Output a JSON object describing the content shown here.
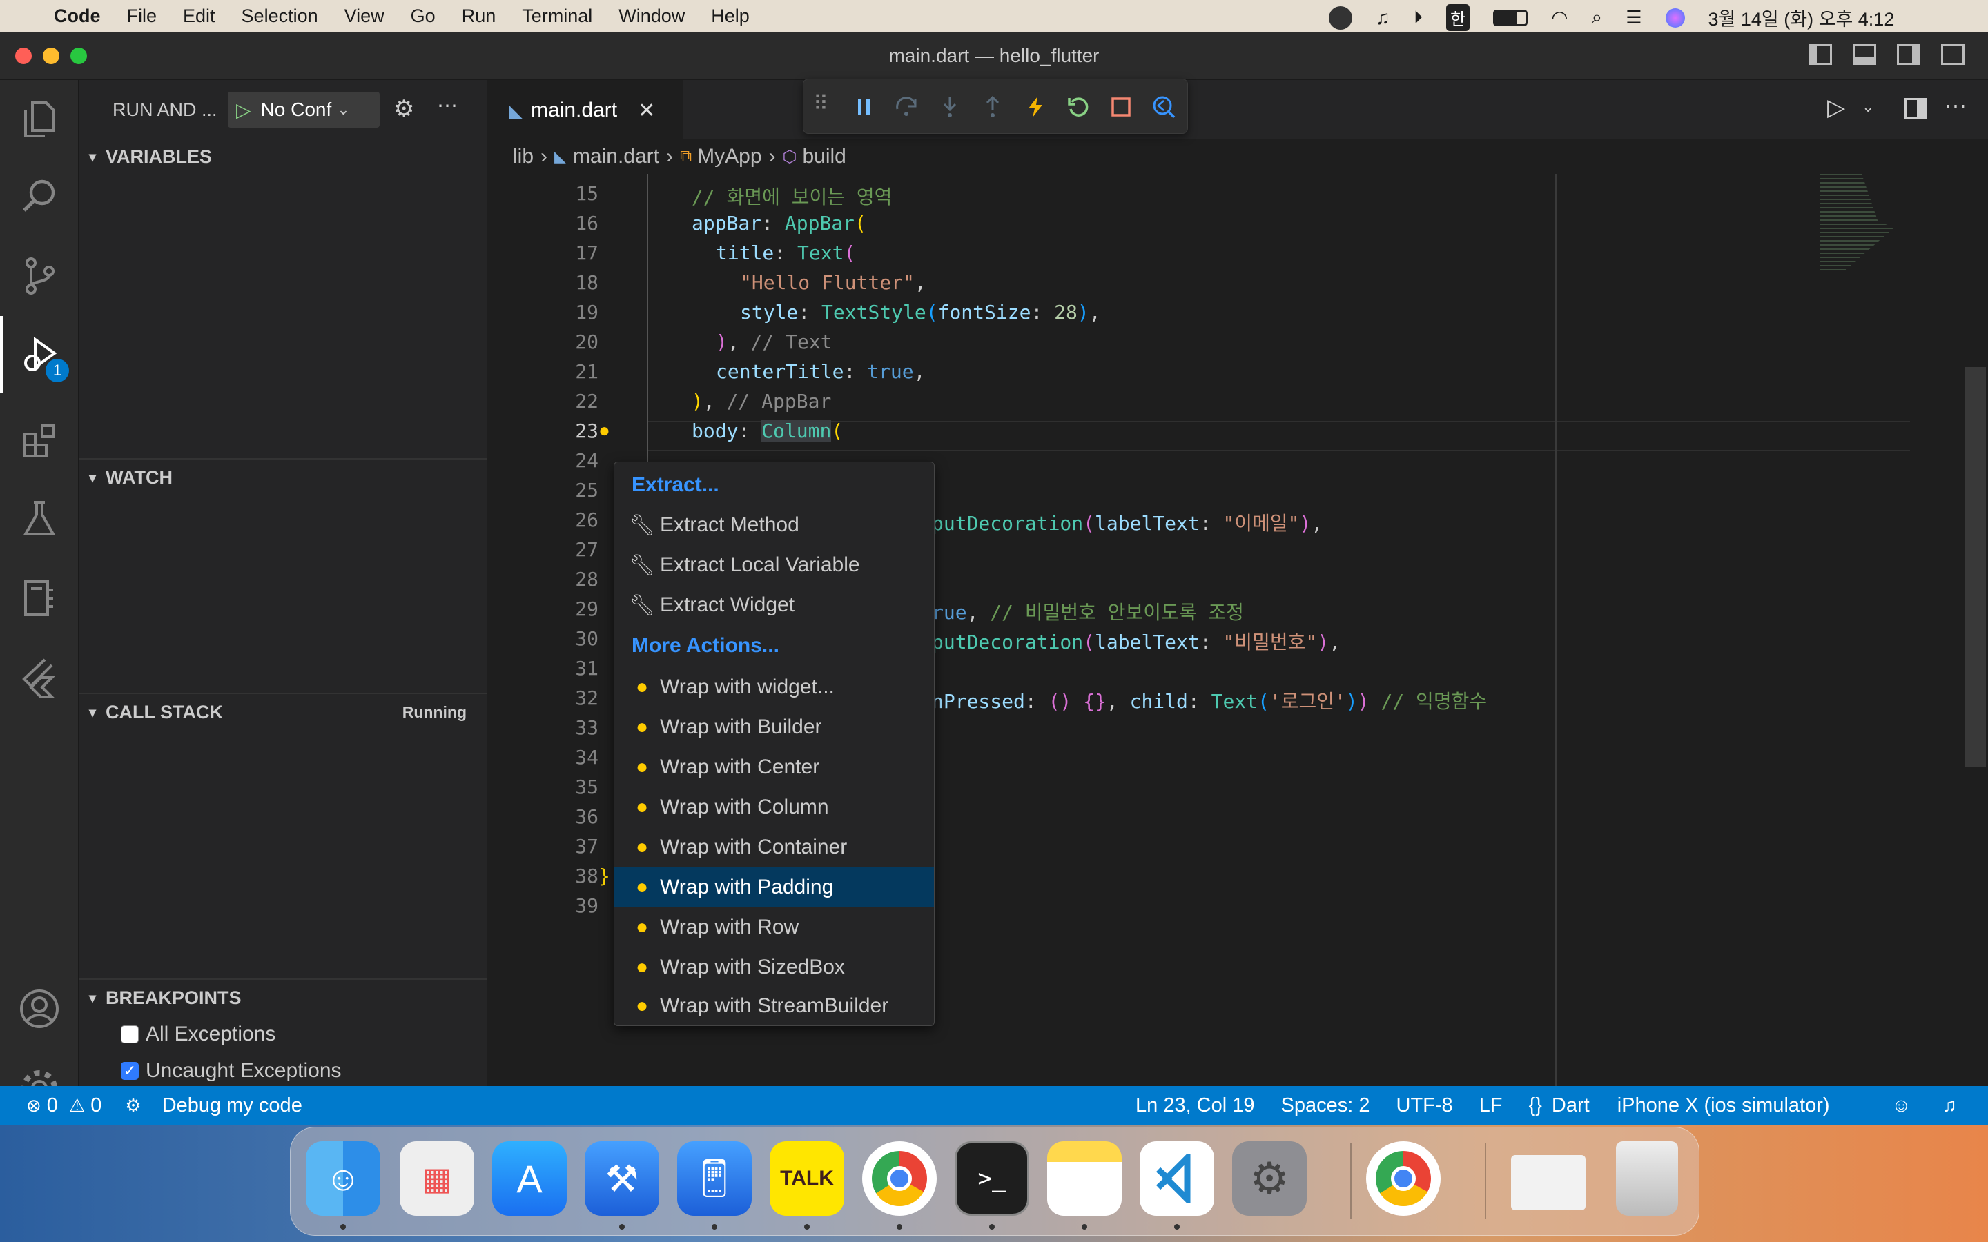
{
  "menubar": {
    "app_name": "Code",
    "items": [
      "File",
      "Edit",
      "Selection",
      "View",
      "Go",
      "Run",
      "Terminal",
      "Window",
      "Help"
    ],
    "ime": "한",
    "datetime": "3월 14일 (화) 오후 4:12"
  },
  "window": {
    "title": "main.dart — hello_flutter"
  },
  "activity": {
    "debug_badge": "1"
  },
  "sidebar": {
    "run_title": "RUN AND ...",
    "config": "No Conf",
    "variables": "VARIABLES",
    "watch": "WATCH",
    "call_stack": "CALL STACK",
    "call_stack_status": "Running",
    "breakpoints": "BREAKPOINTS",
    "bp_items": [
      {
        "label": "All Exceptions",
        "checked": false
      },
      {
        "label": "Uncaught Exceptions",
        "checked": true
      }
    ]
  },
  "editor": {
    "tab_label": "main.dart",
    "breadcrumb": [
      "lib",
      "main.dart",
      "MyApp",
      "build"
    ],
    "line_numbers": [
      "15",
      "16",
      "17",
      "18",
      "19",
      "20",
      "21",
      "22",
      "23",
      "24",
      "25",
      "26",
      "27",
      "28",
      "29",
      "30",
      "31",
      "32",
      "33",
      "34",
      "35",
      "36",
      "37",
      "38",
      "39"
    ],
    "code": {
      "l15": "// 화면에 보이는 영역",
      "l16a": "appBar",
      "l16b": "AppBar",
      "l17a": "title",
      "l17b": "Text",
      "l18": "\"Hello Flutter\"",
      "l19a": "style",
      "l19b": "TextStyle",
      "l19c": "fontSize",
      "l19d": "28",
      "l20": "// Text",
      "l21a": "centerTitle",
      "l21b": "true",
      "l22": "// AppBar",
      "l23a": "body",
      "l23b": "Column",
      "l26a": "putDecoration",
      "l26b": "labelText",
      "l26c": "\"이메일\"",
      "l29a": "rue",
      "l29b": "// 비밀번호 안보이도록 조정",
      "l30a": "putDecoration",
      "l30b": "labelText",
      "l30c": "\"비밀번호\"",
      "l32a": "nPressed",
      "l32b": "child",
      "l32c": "Text",
      "l32d": "'로그인'",
      "l32e": "// 익명함수",
      "l38": "}"
    }
  },
  "popup": {
    "extract_header": "Extract...",
    "extract_items": [
      "Extract Method",
      "Extract Local Variable",
      "Extract Widget"
    ],
    "more_header": "More Actions...",
    "wrap_items": [
      "Wrap with widget...",
      "Wrap with Builder",
      "Wrap with Center",
      "Wrap with Column",
      "Wrap with Container",
      "Wrap with Padding",
      "Wrap with Row",
      "Wrap with SizedBox",
      "Wrap with StreamBuilder"
    ],
    "selected": "Wrap with Padding"
  },
  "statusbar": {
    "errors": "0",
    "warnings": "0",
    "debug": "Debug my code",
    "position": "Ln 23, Col 19",
    "spaces": "Spaces: 2",
    "encoding": "UTF-8",
    "eol": "LF",
    "language": "Dart",
    "device": "iPhone X (ios simulator)"
  },
  "dock": {
    "kakao": "TALK"
  },
  "colors": {
    "accent": "#007acc",
    "selection": "#04395e",
    "bulb": "#ffcc00"
  }
}
